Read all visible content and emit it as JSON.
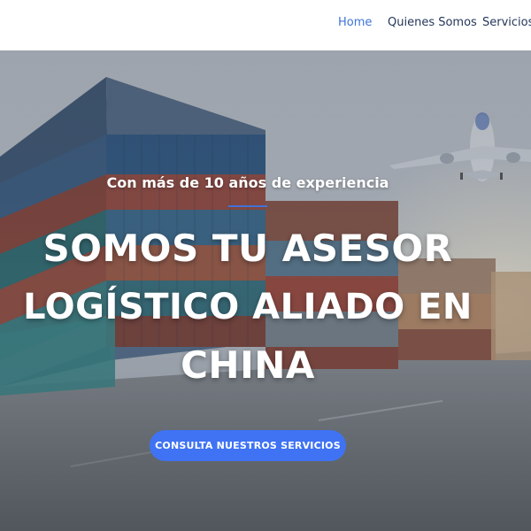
{
  "nav": {
    "items": [
      {
        "label": "Home",
        "active": true
      },
      {
        "label": "Quienes Somos",
        "active": false
      },
      {
        "label": "Servicios",
        "active": false
      }
    ]
  },
  "hero": {
    "subtitle": "Con más de 10 años de experiencia",
    "headline_lines": [
      "SOMOS TU ASESOR",
      "LOGÍSTICO ALIADO EN",
      "CHINA"
    ],
    "cta_label": "CONSULTA NUESTROS SERVICIOS",
    "background_image": "shipping containers with cargo airplane"
  },
  "colors": {
    "accent": "#3f73d9",
    "button": "#3f73f4",
    "nav_text": "#24375a",
    "hero_text": "#ffffff"
  }
}
